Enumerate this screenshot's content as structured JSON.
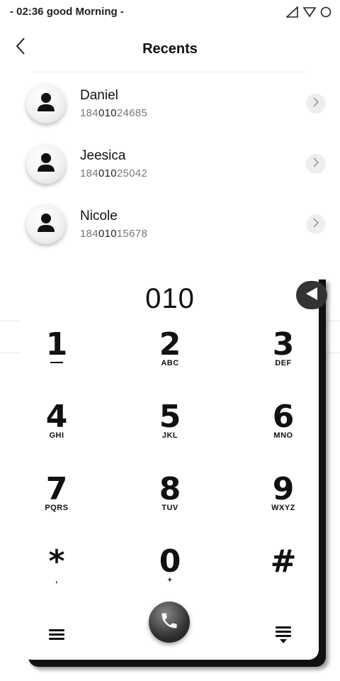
{
  "status_bar": {
    "text": "- 02:36  good Morning -",
    "icons": [
      "signal-icon",
      "wifi-icon",
      "circle-icon"
    ]
  },
  "header": {
    "title": "Recents",
    "back_icon": "chevron-left-icon"
  },
  "contacts": [
    {
      "name": "Daniel",
      "number_prefix": "184",
      "number_match": "010",
      "number_suffix": "24685"
    },
    {
      "name": "Jeesica",
      "number_prefix": "184",
      "number_match": "010",
      "number_suffix": "25042"
    },
    {
      "name": "Nicole",
      "number_prefix": "184",
      "number_match": "010",
      "number_suffix": "15678"
    }
  ],
  "dialer": {
    "display": "010",
    "keys": [
      {
        "digit": "1",
        "letters": ""
      },
      {
        "digit": "2",
        "letters": "ABC"
      },
      {
        "digit": "3",
        "letters": "DEF"
      },
      {
        "digit": "4",
        "letters": "GHI"
      },
      {
        "digit": "5",
        "letters": "JKL"
      },
      {
        "digit": "6",
        "letters": "MNO"
      },
      {
        "digit": "7",
        "letters": "PQRS"
      },
      {
        "digit": "8",
        "letters": "TUV"
      },
      {
        "digit": "9",
        "letters": "WXYZ"
      },
      {
        "digit": "*",
        "letters": ","
      },
      {
        "digit": "0",
        "letters": "+"
      },
      {
        "digit": "#",
        "letters": ""
      }
    ]
  }
}
